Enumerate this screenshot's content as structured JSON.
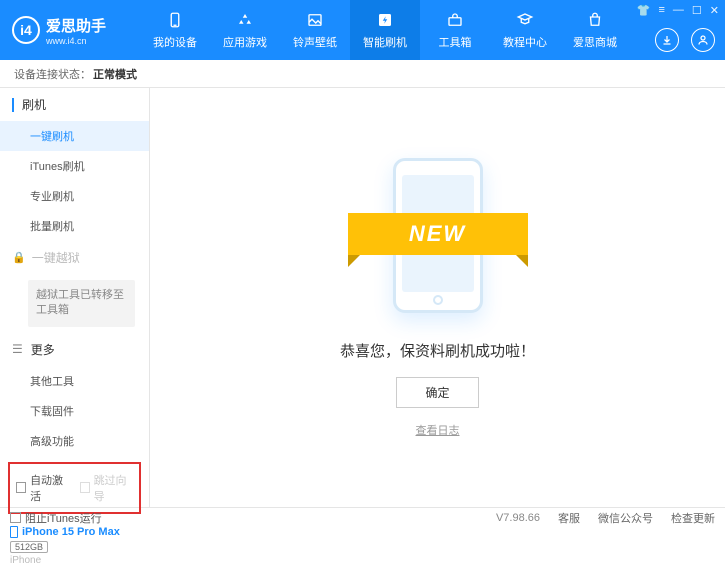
{
  "brand": {
    "title": "爱思助手",
    "url": "www.i4.cn",
    "logo_letter": "i4"
  },
  "nav": [
    {
      "label": "我的设备"
    },
    {
      "label": "应用游戏"
    },
    {
      "label": "铃声壁纸"
    },
    {
      "label": "智能刷机",
      "active": true
    },
    {
      "label": "工具箱"
    },
    {
      "label": "教程中心"
    },
    {
      "label": "爱思商城"
    }
  ],
  "status": {
    "label": "设备连接状态：",
    "value": "正常模式"
  },
  "sidebar": {
    "flash": {
      "head": "刷机",
      "items": [
        "一键刷机",
        "iTunes刷机",
        "专业刷机",
        "批量刷机"
      ]
    },
    "jailbreak": {
      "head": "一键越狱",
      "note": "越狱工具已转移至工具箱"
    },
    "more": {
      "head": "更多",
      "items": [
        "其他工具",
        "下载固件",
        "高级功能"
      ]
    },
    "checkboxes": {
      "auto_activate": "自动激活",
      "skip_setup": "跳过向导"
    }
  },
  "device": {
    "name": "iPhone 15 Pro Max",
    "storage": "512GB",
    "type": "iPhone"
  },
  "main": {
    "ribbon": "NEW",
    "message": "恭喜您，保资料刷机成功啦！",
    "ok": "确定",
    "log": "查看日志"
  },
  "footer": {
    "block_itunes": "阻止iTunes运行",
    "version": "V7.98.66",
    "links": [
      "客服",
      "微信公众号",
      "检查更新"
    ]
  }
}
